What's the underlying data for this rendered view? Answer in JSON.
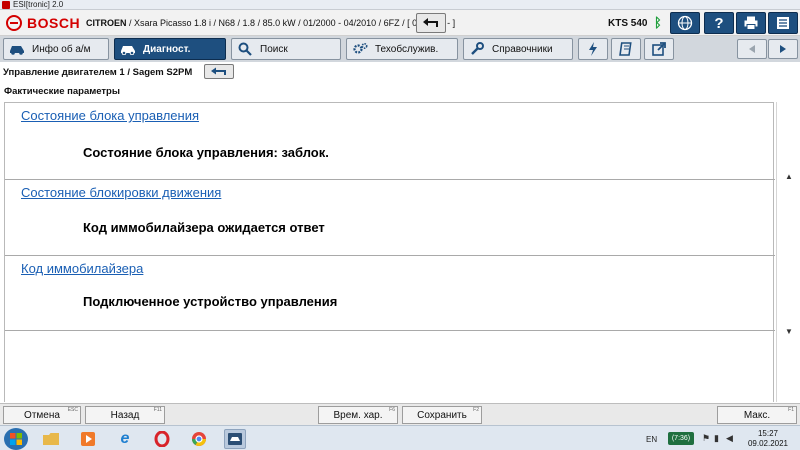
{
  "window": {
    "title": "ESI[tronic] 2.0"
  },
  "header": {
    "brand": "BOSCH",
    "vehicle_make": "CITROEN",
    "vehicle_details": " / Xsara Picasso 1.8 i / N68 / 1.8 / 85.0 kW / 01/2000 - 04/2010 / 6FZ / [ 01/2002 - ]",
    "device": "KTS 540"
  },
  "tabs": [
    {
      "label": "Инфо об а/м",
      "icon": "car-icon"
    },
    {
      "label": "Диагност.",
      "icon": "car-diagnostics-icon",
      "active": true
    },
    {
      "label": "Поиск",
      "icon": "search-icon"
    },
    {
      "label": "Техобслужив.",
      "icon": "gears-icon"
    },
    {
      "label": "Справочники",
      "icon": "wrench-icon"
    }
  ],
  "breadcrumb": {
    "text": "Управление двигателем 1 / Sagem S2PM"
  },
  "section": {
    "title": "Фактические параметры"
  },
  "items": [
    {
      "label": "Состояние блока управления",
      "value": "Состояние блока управления: заблок."
    },
    {
      "label": "Состояние блокировки движения",
      "value": "Код иммобилайзера ожидается ответ"
    },
    {
      "label": "Код иммобилайзера",
      "value": "Подключенное устройство управления"
    }
  ],
  "actions": {
    "cancel": {
      "label": "Отмена",
      "key": "ESC"
    },
    "back": {
      "label": "Назад",
      "key": "F11"
    },
    "time_chart": {
      "label": "Врем. хар.",
      "key": "F6"
    },
    "save": {
      "label": "Сохранить",
      "key": "F2"
    },
    "max": {
      "label": "Макс.",
      "key": "F1"
    }
  },
  "taskbar": {
    "language": "EN",
    "battery": "(7:36)",
    "time": "15:27",
    "date": "09.02.2021"
  },
  "colors": {
    "brand_red": "#d40000",
    "accent_blue": "#1e4f7f",
    "link_blue": "#1a5fb4",
    "bluetooth_green": "#1e9e3a"
  }
}
